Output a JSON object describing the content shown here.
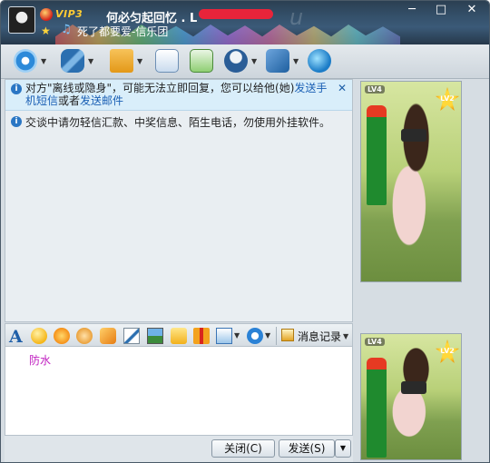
{
  "titlebar": {
    "vip": "VIP3",
    "nickname": "何必匀起回忆 . L",
    "signature": "死了都要爱-信乐团",
    "watermark": "u",
    "buttons": {
      "minimize": "─",
      "maximize": "□",
      "close": "✕"
    }
  },
  "toolbar": {
    "items": [
      {
        "name": "video-call",
        "icon": "webcam-icon"
      },
      {
        "name": "voice-call",
        "icon": "microphone-icon"
      },
      {
        "name": "send-file",
        "icon": "folder-icon"
      },
      {
        "name": "send-mail",
        "icon": "mail-icon"
      },
      {
        "name": "add-app",
        "icon": "add-app-icon"
      },
      {
        "name": "buddy-info",
        "icon": "user-icon"
      },
      {
        "name": "app-settings",
        "icon": "app-icon"
      },
      {
        "name": "qzone",
        "icon": "globe-icon"
      }
    ],
    "dropdown": "▼"
  },
  "chat": {
    "info_prefix": "对方\"离线或隐身\"，可能无法立即回复，您可以给他(她)",
    "info_link_sms": "发送手机短信",
    "info_or": "或者",
    "info_link_mail": "发送邮件",
    "info_close": "✕",
    "warning": "交谈中请勿轻信汇款、中奖信息、陌生电话，勿使用外挂软件。",
    "info_glyph": "i"
  },
  "inputbar": {
    "font_glyph": "A",
    "history_label": "消息记录",
    "dropdown": "▼"
  },
  "input": {
    "text": "防水"
  },
  "buttons": {
    "close_label": "关闭(C)",
    "send_label": "发送(S)",
    "send_drop": "▼"
  },
  "show": {
    "level_top": "LV4",
    "level_badge": "LV2"
  },
  "colors": {
    "titlebar": "#34506a",
    "info_background": "#d9eefa",
    "link": "#1a5fb4",
    "input_text": "#c020c0"
  }
}
